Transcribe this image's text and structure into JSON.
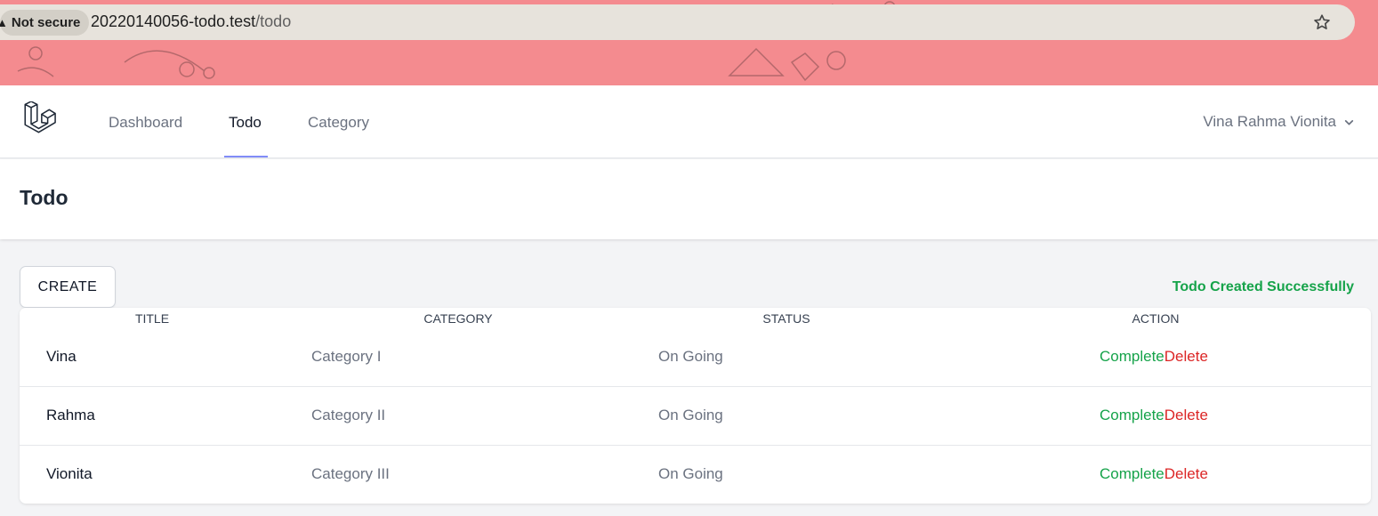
{
  "browser": {
    "security_label": "Not secure",
    "url_host": "20220140056-todo.test",
    "url_path": "/todo"
  },
  "nav": {
    "links": [
      {
        "label": "Dashboard"
      },
      {
        "label": "Todo"
      },
      {
        "label": "Category"
      }
    ],
    "active": "Todo",
    "user_name": "Vina Rahma Vionita"
  },
  "header": {
    "title": "Todo"
  },
  "toolbar": {
    "create_label": "CREATE",
    "flash_message": "Todo Created Successfully"
  },
  "table": {
    "columns": [
      "TITLE",
      "CATEGORY",
      "STATUS",
      "ACTION"
    ],
    "rows": [
      {
        "title": "Vina",
        "category": "Category I",
        "status": "On Going",
        "complete": "Complete",
        "delete": "Delete"
      },
      {
        "title": "Rahma",
        "category": "Category II",
        "status": "On Going",
        "complete": "Complete",
        "delete": "Delete"
      },
      {
        "title": "Vionita",
        "category": "Category III",
        "status": "On Going",
        "complete": "Complete",
        "delete": "Delete"
      }
    ]
  },
  "colors": {
    "chrome_bg": "#f48b8f",
    "success": "#16a34a",
    "danger": "#dc2626",
    "accent": "#818cf8"
  },
  "icons": [
    "warning-icon",
    "star-icon",
    "laravel-logo-icon",
    "chevron-down-icon"
  ]
}
